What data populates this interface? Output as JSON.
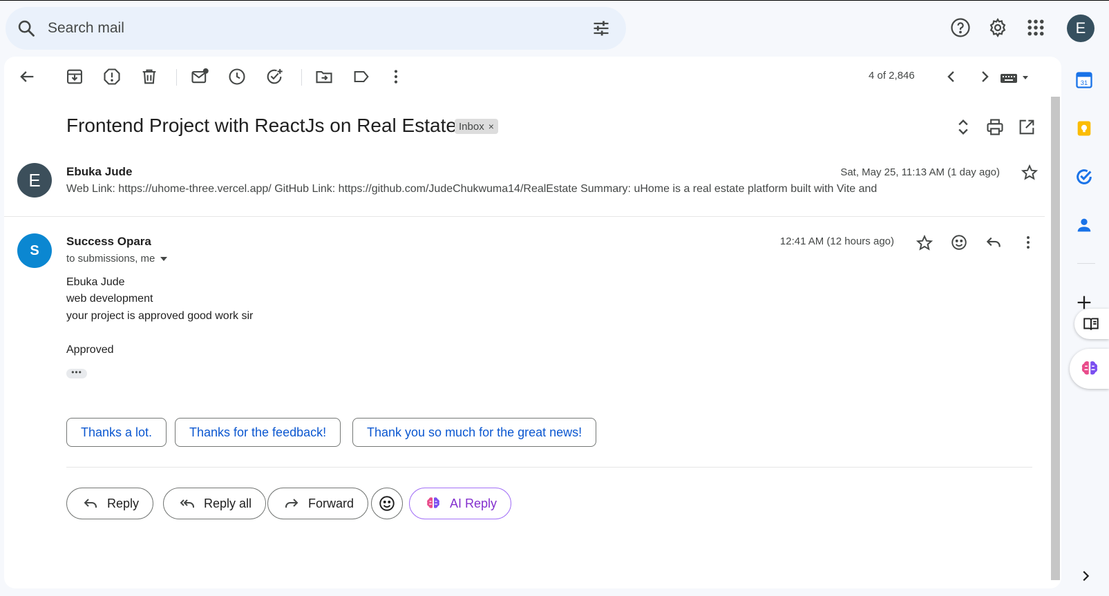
{
  "search": {
    "placeholder": "Search mail"
  },
  "account": {
    "initial": "E"
  },
  "toolbar": {
    "count": "4 of 2,846"
  },
  "thread": {
    "subject": "Frontend Project with ReactJs on Real Estate",
    "label": "Inbox",
    "label_close": "×"
  },
  "messages": [
    {
      "initial": "E",
      "avatar_color": "#3c4f5b",
      "sender": "Ebuka Jude",
      "date": "Sat, May 25, 11:13 AM (1 day ago)",
      "snippet": "Web Link: https://uhome-three.vercel.app/ GitHub Link: https://github.com/JudeChukwuma14/RealEstate Summary: uHome is a real estate platform built with Vite and"
    },
    {
      "initial": "S",
      "avatar_color": "#0b87d1",
      "sender": "Success Opara",
      "date": "12:41 AM (12 hours ago)",
      "to": "to submissions, me",
      "body": [
        "Ebuka Jude",
        "web development",
        "your project is approved good work sir",
        "Approved"
      ],
      "trimmed": "•••"
    }
  ],
  "smart_replies": [
    "Thanks a lot.",
    "Thanks for the feedback!",
    "Thank you so much for the great news!"
  ],
  "actions": {
    "reply": "Reply",
    "reply_all": "Reply all",
    "forward": "Forward",
    "ai_reply": "AI Reply"
  },
  "side_panel": {
    "calendar_day": "31"
  },
  "colors": {
    "accent": "#0b57d0",
    "ai": "#8430ce",
    "keep": "#fbbc04",
    "tasks": "#1a73e8"
  }
}
